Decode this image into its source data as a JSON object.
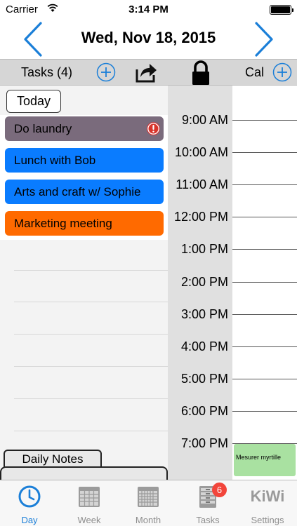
{
  "status": {
    "carrier": "Carrier",
    "time": "3:14 PM"
  },
  "header": {
    "date": "Wed, Nov 18, 2015"
  },
  "toolbar": {
    "tasks_label": "Tasks (4)",
    "cal_label": "Cal"
  },
  "today_button": "Today",
  "tasks": [
    {
      "label": "Do laundry",
      "color": "#7a6b7c",
      "flag": "alert-icon"
    },
    {
      "label": "Lunch with Bob",
      "color": "#0a7cff"
    },
    {
      "label": "Arts and craft w/ Sophie",
      "color": "#0a7cff"
    },
    {
      "label": "Marketing meeting",
      "color": "#ff6a00"
    }
  ],
  "daily_notes": "Daily Notes",
  "hours": [
    "9:00 AM",
    "10:00 AM",
    "11:00 AM",
    "12:00 PM",
    "1:00 PM",
    "2:00 PM",
    "3:00 PM",
    "4:00 PM",
    "5:00 PM",
    "6:00 PM",
    "7:00 PM"
  ],
  "event": {
    "label": "Mesurer myrtille",
    "color": "#a9e1a1"
  },
  "tabbar": {
    "day": "Day",
    "week": "Week",
    "month": "Month",
    "tasks": "Tasks",
    "tasks_badge": "6",
    "settings_logo": "KiWi",
    "settings": "Settings"
  },
  "colors": {
    "accent": "#1b7fd8",
    "badge": "#f2453b"
  }
}
